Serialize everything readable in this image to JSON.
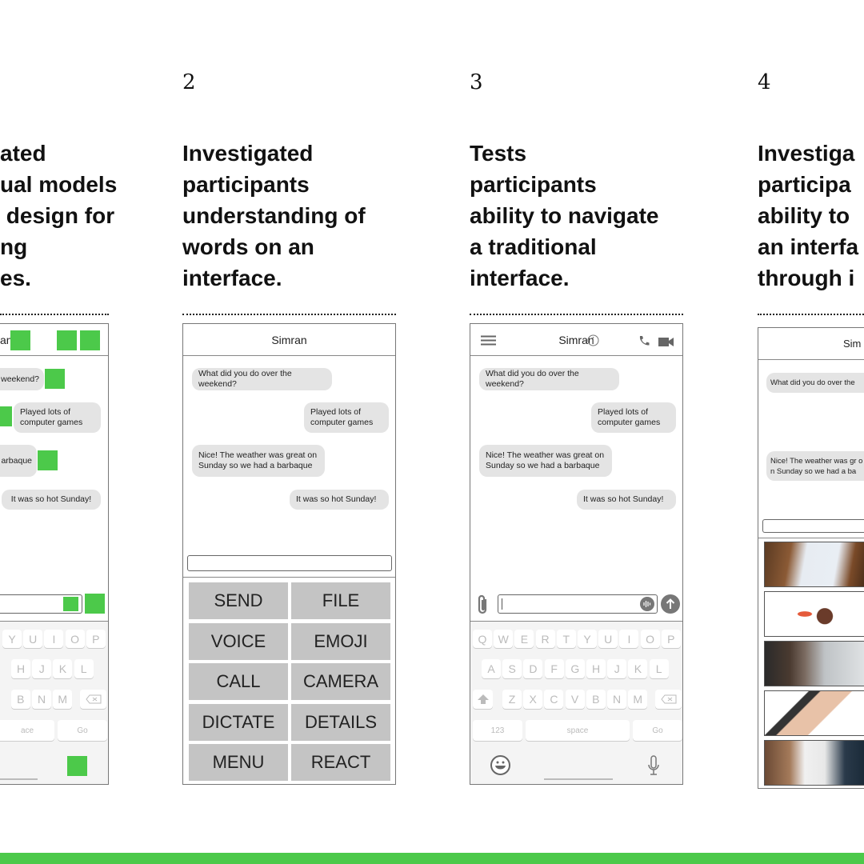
{
  "columns": [
    {
      "number": "",
      "title_lines": [
        "ated",
        "ual models",
        " design for",
        "ng",
        "es."
      ]
    },
    {
      "number": "2",
      "title_lines": [
        "Investigated",
        "participants",
        "understanding of",
        "words on an",
        "interface."
      ]
    },
    {
      "number": "3",
      "title_lines": [
        "Tests",
        "participants",
        "ability to navigate",
        "a traditional",
        "interface."
      ]
    },
    {
      "number": "4",
      "title_lines": [
        "Investiga",
        "participa",
        "ability to",
        "an interfa",
        "through i"
      ]
    }
  ],
  "chat": {
    "contact": "Simran",
    "messages": [
      {
        "side": "left",
        "text": "What did you do over the weekend?"
      },
      {
        "side": "right",
        "text": "Played lots of computer games"
      },
      {
        "side": "left",
        "text": "Nice! The weather was great on Sunday so we had a barbaque"
      },
      {
        "side": "right",
        "text": "It was so hot Sunday!"
      }
    ],
    "phone1_messages": [
      "weekend?",
      "Played lots of computer games",
      "reat arbaque",
      "It was so hot Sunday!"
    ],
    "phone1_contact": "an",
    "phone4_contact": "Sim",
    "phone4_messages": [
      "What did you do over the",
      "Nice! The weather was gr on Sunday so we had a ba"
    ]
  },
  "keyboard": {
    "row1": [
      "Q",
      "W",
      "E",
      "R",
      "T",
      "Y",
      "U",
      "I",
      "O",
      "P"
    ],
    "row2": [
      "A",
      "S",
      "D",
      "F",
      "G",
      "H",
      "J",
      "K",
      "L"
    ],
    "row3": [
      "Z",
      "X",
      "C",
      "V",
      "B",
      "N",
      "M"
    ],
    "numbers": "123",
    "space": "space",
    "go": "Go",
    "phone1_space": "ace"
  },
  "word_buttons": [
    "SEND",
    "FILE",
    "VOICE",
    "EMOJI",
    "CALL",
    "CAMERA",
    "DICTATE",
    "DETAILS",
    "MENU",
    "REACT"
  ],
  "image_options": [
    "envelope-photo",
    "voice-message-photo",
    "phone-call-photo",
    "microphone-photo",
    "menu-photo"
  ],
  "colors": {
    "accent": "#4cc94a",
    "bubble": "#e4e4e4",
    "button": "#c4c4c4",
    "icon": "#777777"
  }
}
